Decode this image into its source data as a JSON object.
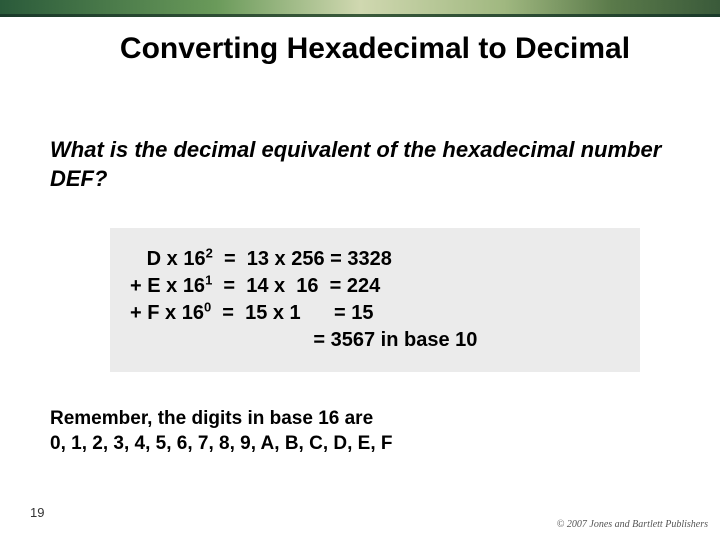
{
  "slide": {
    "title": "Converting Hexadecimal to Decimal",
    "question": "What is the decimal equivalent of the hexadecimal number DEF?",
    "calc": {
      "line1_a": "   D x 16",
      "line1_exp": "2",
      "line1_b": "  =  13 x 256 = 3328",
      "line2_a": "+ E x 16",
      "line2_exp": "1",
      "line2_b": "  =  14 x  16  = 224",
      "line3_a": "+ F x 16",
      "line3_exp": "0",
      "line3_b": "  =  15 x 1      = 15",
      "line4": "                                 = 3567 in base 10"
    },
    "remember_line1": "Remember, the digits in base 16 are",
    "remember_line2": "0, 1, 2, 3, 4, 5, 6, 7, 8, 9, A, B, C, D, E, F",
    "page_number": "19",
    "copyright": "© 2007 Jones and Bartlett Publishers"
  }
}
